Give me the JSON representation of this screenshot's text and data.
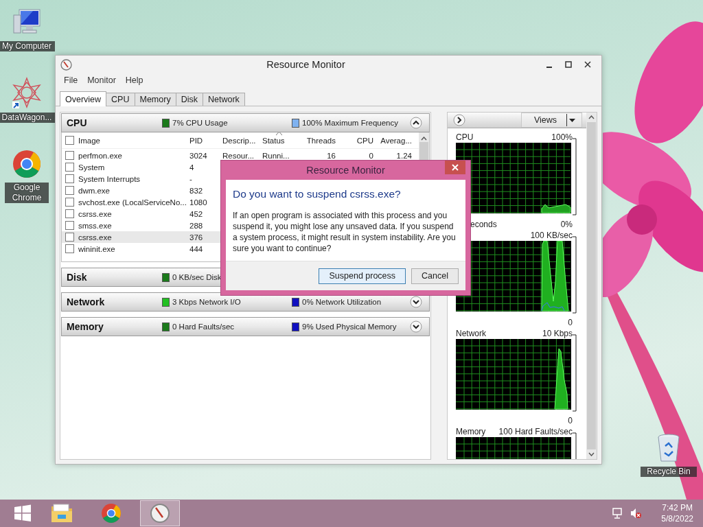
{
  "desktop_icons": [
    {
      "label": "My Computer",
      "kind": "computer"
    },
    {
      "label": "DataWagon...",
      "kind": "app"
    },
    {
      "label": "Google Chrome",
      "kind": "browser"
    },
    {
      "label": "Recycle Bin",
      "kind": "recycle"
    }
  ],
  "window": {
    "title": "Resource Monitor",
    "menu": [
      "File",
      "Monitor",
      "Help"
    ],
    "tabs": [
      {
        "label": "Overview",
        "selected": true
      },
      {
        "label": "CPU",
        "selected": false
      },
      {
        "label": "Memory",
        "selected": false
      },
      {
        "label": "Disk",
        "selected": false
      },
      {
        "label": "Network",
        "selected": false
      }
    ],
    "sections": [
      {
        "title": "CPU",
        "expanded": true,
        "stats": [
          {
            "text": "7% CPU Usage",
            "color": "#1b7a1b"
          },
          {
            "text": "100% Maximum Frequency",
            "color": "#7fb2f0"
          }
        ],
        "table": {
          "select_all": {
            "checked": false
          },
          "columns": [
            {
              "label": "Image",
              "sorted": false
            },
            {
              "label": "PID",
              "sorted": false
            },
            {
              "label": "Descrip...",
              "sorted": false
            },
            {
              "label": "Status",
              "sorted": true
            },
            {
              "label": "Threads",
              "sorted": false
            },
            {
              "label": "CPU",
              "sorted": false
            },
            {
              "label": "Averag...",
              "sorted": false
            }
          ],
          "rows": [
            {
              "image": "perfmon.exe",
              "pid": "3024",
              "description": "Resour...",
              "status": "Runni...",
              "threads": "16",
              "cpu": "0",
              "average": "1.24",
              "checked": false,
              "selected": false
            },
            {
              "image": "System",
              "pid": "4",
              "checked": false,
              "selected": false
            },
            {
              "image": "System Interrupts",
              "pid": "-",
              "checked": false,
              "selected": false
            },
            {
              "image": "dwm.exe",
              "pid": "832",
              "checked": false,
              "selected": false
            },
            {
              "image": "svchost.exe (LocalServiceNo...",
              "pid": "1080",
              "checked": false,
              "selected": false
            },
            {
              "image": "csrss.exe",
              "pid": "452",
              "checked": false,
              "selected": false
            },
            {
              "image": "smss.exe",
              "pid": "288",
              "checked": false,
              "selected": false
            },
            {
              "image": "csrss.exe",
              "pid": "376",
              "checked": false,
              "selected": true
            },
            {
              "image": "wininit.exe",
              "pid": "444",
              "checked": false,
              "selected": false
            }
          ]
        }
      },
      {
        "title": "Disk",
        "stats": [
          {
            "text": "0 KB/sec Disk",
            "color": "#1b7a1b"
          }
        ]
      },
      {
        "title": "Network",
        "expanded": false,
        "stats": [
          {
            "text": "3 Kbps Network I/O",
            "color": "#22c022"
          },
          {
            "text": "0% Network Utilization",
            "color": "#1010c0"
          }
        ]
      },
      {
        "title": "Memory",
        "expanded": false,
        "stats": [
          {
            "text": "0 Hard Faults/sec",
            "color": "#1b7a1b"
          },
          {
            "text": "9% Used Physical Memory",
            "color": "#1010c0"
          }
        ]
      }
    ],
    "graph_panel": {
      "views_button": "Views",
      "graphs": [
        {
          "title": "CPU",
          "scale_max": "100%",
          "time_label": "econds",
          "scale_min": "0%"
        },
        {
          "scale_max": "100 KB/sec",
          "scale_min": "0"
        },
        {
          "title": "Network",
          "scale_max": "10 Kbps",
          "scale_min": "0"
        },
        {
          "title": "Memory",
          "scale_max": "100 Hard Faults/sec"
        }
      ]
    }
  },
  "dialog": {
    "title": "Resource Monitor",
    "heading": "Do you want to suspend csrss.exe?",
    "message": "If an open program is associated with this process and you suspend it, you might lose any unsaved data. If you suspend a system process, it might result in system instability. Are you sure you want to continue?",
    "buttons": [
      {
        "label": "Suspend process",
        "default": true
      },
      {
        "label": "Cancel",
        "default": false
      }
    ]
  },
  "taskbar": {
    "items": [
      {
        "kind": "start",
        "selected": false
      },
      {
        "kind": "folder",
        "selected": false
      },
      {
        "kind": "browser",
        "selected": false
      },
      {
        "kind": "monitor",
        "selected": true
      }
    ],
    "time": "7:42 PM",
    "date": "5/8/2022"
  }
}
